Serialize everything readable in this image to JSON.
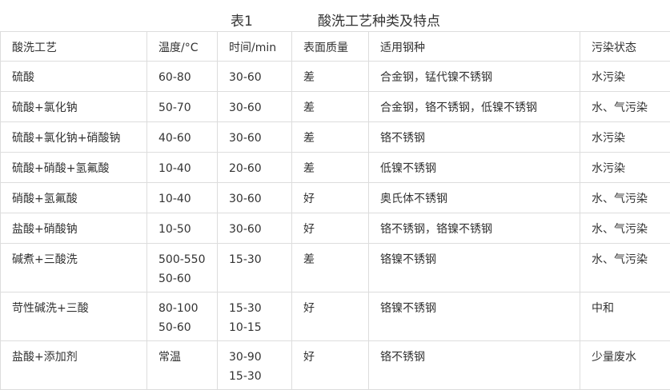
{
  "title": {
    "number": "表1",
    "name": "酸洗工艺种类及特点"
  },
  "table": {
    "headers": [
      "酸洗工艺",
      "温度/°C",
      "时间/min",
      "表面质量",
      "适用钢种",
      "污染状态"
    ],
    "rows": [
      [
        [
          "硫酸"
        ],
        [
          "60-80"
        ],
        [
          "30-60"
        ],
        [
          "差"
        ],
        [
          "合金钢，锰代镍不锈钢"
        ],
        [
          "水污染"
        ]
      ],
      [
        [
          "硫酸+氯化钠"
        ],
        [
          "50-70"
        ],
        [
          "30-60"
        ],
        [
          "差"
        ],
        [
          "合金钢，铬不锈钢，低镍不锈钢"
        ],
        [
          "水、气污染"
        ]
      ],
      [
        [
          "硫酸+氯化钠+硝酸钠"
        ],
        [
          "40-60"
        ],
        [
          "30-60"
        ],
        [
          "差"
        ],
        [
          "铬不锈钢"
        ],
        [
          "水污染"
        ]
      ],
      [
        [
          "硫酸+硝酸+氢氟酸"
        ],
        [
          "10-40"
        ],
        [
          "20-60"
        ],
        [
          "差"
        ],
        [
          "低镍不锈钢"
        ],
        [
          "水污染"
        ]
      ],
      [
        [
          "硝酸+氢氟酸"
        ],
        [
          "10-40"
        ],
        [
          "30-60"
        ],
        [
          "好"
        ],
        [
          "奥氏体不锈钢"
        ],
        [
          "水、气污染"
        ]
      ],
      [
        [
          "盐酸+硝酸钠"
        ],
        [
          "10-50"
        ],
        [
          "30-60"
        ],
        [
          "好"
        ],
        [
          "铬不锈钢，铬镍不锈钢"
        ],
        [
          "水、气污染"
        ]
      ],
      [
        [
          "碱煮+三酸洗"
        ],
        [
          "500-550",
          "50-60"
        ],
        [
          "15-30"
        ],
        [
          "差"
        ],
        [
          "铬镍不锈钢"
        ],
        [
          "水、气污染"
        ]
      ],
      [
        [
          "苛性碱洗+三酸"
        ],
        [
          "80-100",
          "50-60"
        ],
        [
          "15-30",
          "10-15"
        ],
        [
          "好"
        ],
        [
          "铬镍不锈钢"
        ],
        [
          "中和"
        ]
      ],
      [
        [
          "盐酸+添加剂"
        ],
        [
          "常温"
        ],
        [
          "30-90",
          "15-30"
        ],
        [
          "好"
        ],
        [
          "铬不锈钢"
        ],
        [
          "少量废水"
        ]
      ]
    ]
  }
}
